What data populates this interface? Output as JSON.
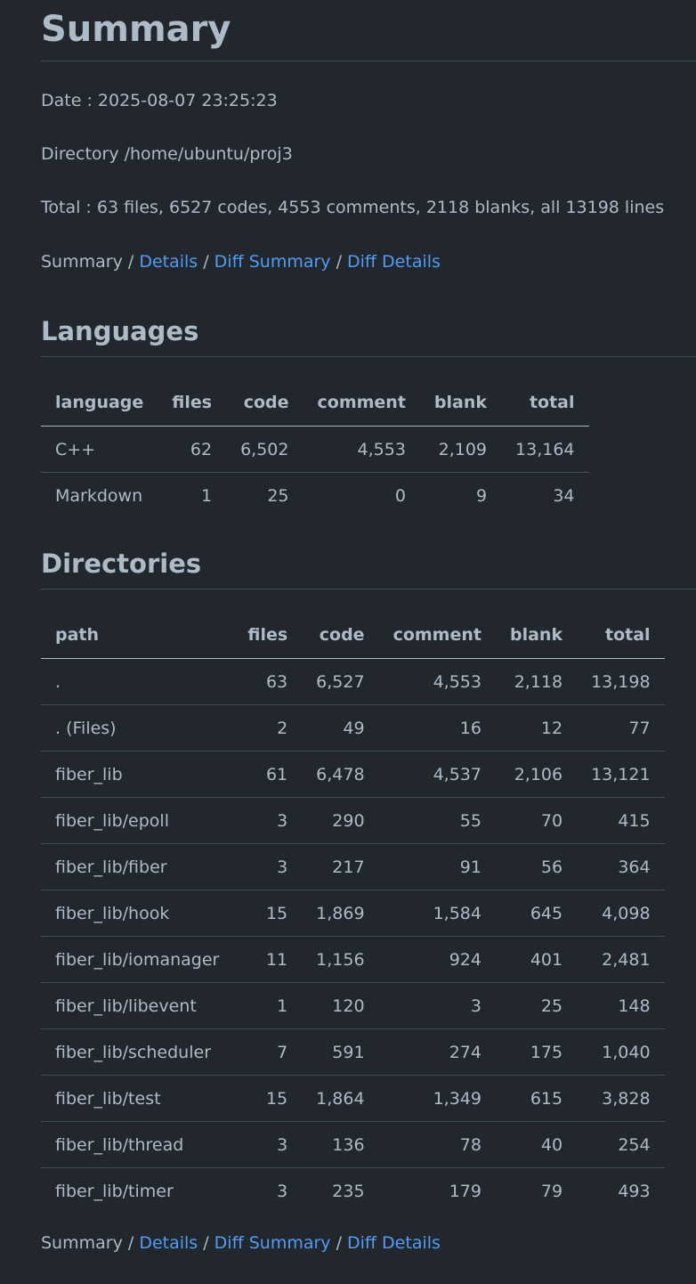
{
  "summary": {
    "title": "Summary",
    "date_line": "Date : 2025-08-07 23:25:23",
    "directory_line": "Directory /home/ubuntu/proj3",
    "total_line": "Total : 63 files, 6527 codes, 4553 comments, 2118 blanks, all 13198 lines"
  },
  "nav": {
    "current": "Summary",
    "separator": " / ",
    "details": "Details",
    "diff_summary": "Diff Summary",
    "diff_details": "Diff Details"
  },
  "languages": {
    "title": "Languages",
    "headers": [
      "language",
      "files",
      "code",
      "comment",
      "blank",
      "total"
    ],
    "rows": [
      [
        "C++",
        "62",
        "6,502",
        "4,553",
        "2,109",
        "13,164"
      ],
      [
        "Markdown",
        "1",
        "25",
        "0",
        "9",
        "34"
      ]
    ]
  },
  "directories": {
    "title": "Directories",
    "headers": [
      "path",
      "files",
      "code",
      "comment",
      "blank",
      "total"
    ],
    "rows": [
      [
        ".",
        "63",
        "6,527",
        "4,553",
        "2,118",
        "13,198"
      ],
      [
        ". (Files)",
        "2",
        "49",
        "16",
        "12",
        "77"
      ],
      [
        "fiber_lib",
        "61",
        "6,478",
        "4,537",
        "2,106",
        "13,121"
      ],
      [
        "fiber_lib/epoll",
        "3",
        "290",
        "55",
        "70",
        "415"
      ],
      [
        "fiber_lib/fiber",
        "3",
        "217",
        "91",
        "56",
        "364"
      ],
      [
        "fiber_lib/hook",
        "15",
        "1,869",
        "1,584",
        "645",
        "4,098"
      ],
      [
        "fiber_lib/iomanager",
        "11",
        "1,156",
        "924",
        "401",
        "2,481"
      ],
      [
        "fiber_lib/libevent",
        "1",
        "120",
        "3",
        "25",
        "148"
      ],
      [
        "fiber_lib/scheduler",
        "7",
        "591",
        "274",
        "175",
        "1,040"
      ],
      [
        "fiber_lib/test",
        "15",
        "1,864",
        "1,349",
        "615",
        "3,828"
      ],
      [
        "fiber_lib/thread",
        "3",
        "136",
        "78",
        "40",
        "254"
      ],
      [
        "fiber_lib/timer",
        "3",
        "235",
        "179",
        "79",
        "493"
      ]
    ]
  },
  "colors": {
    "background": "#22272e",
    "text": "#adbac7",
    "link": "#539bf5",
    "border": "#444c56"
  }
}
